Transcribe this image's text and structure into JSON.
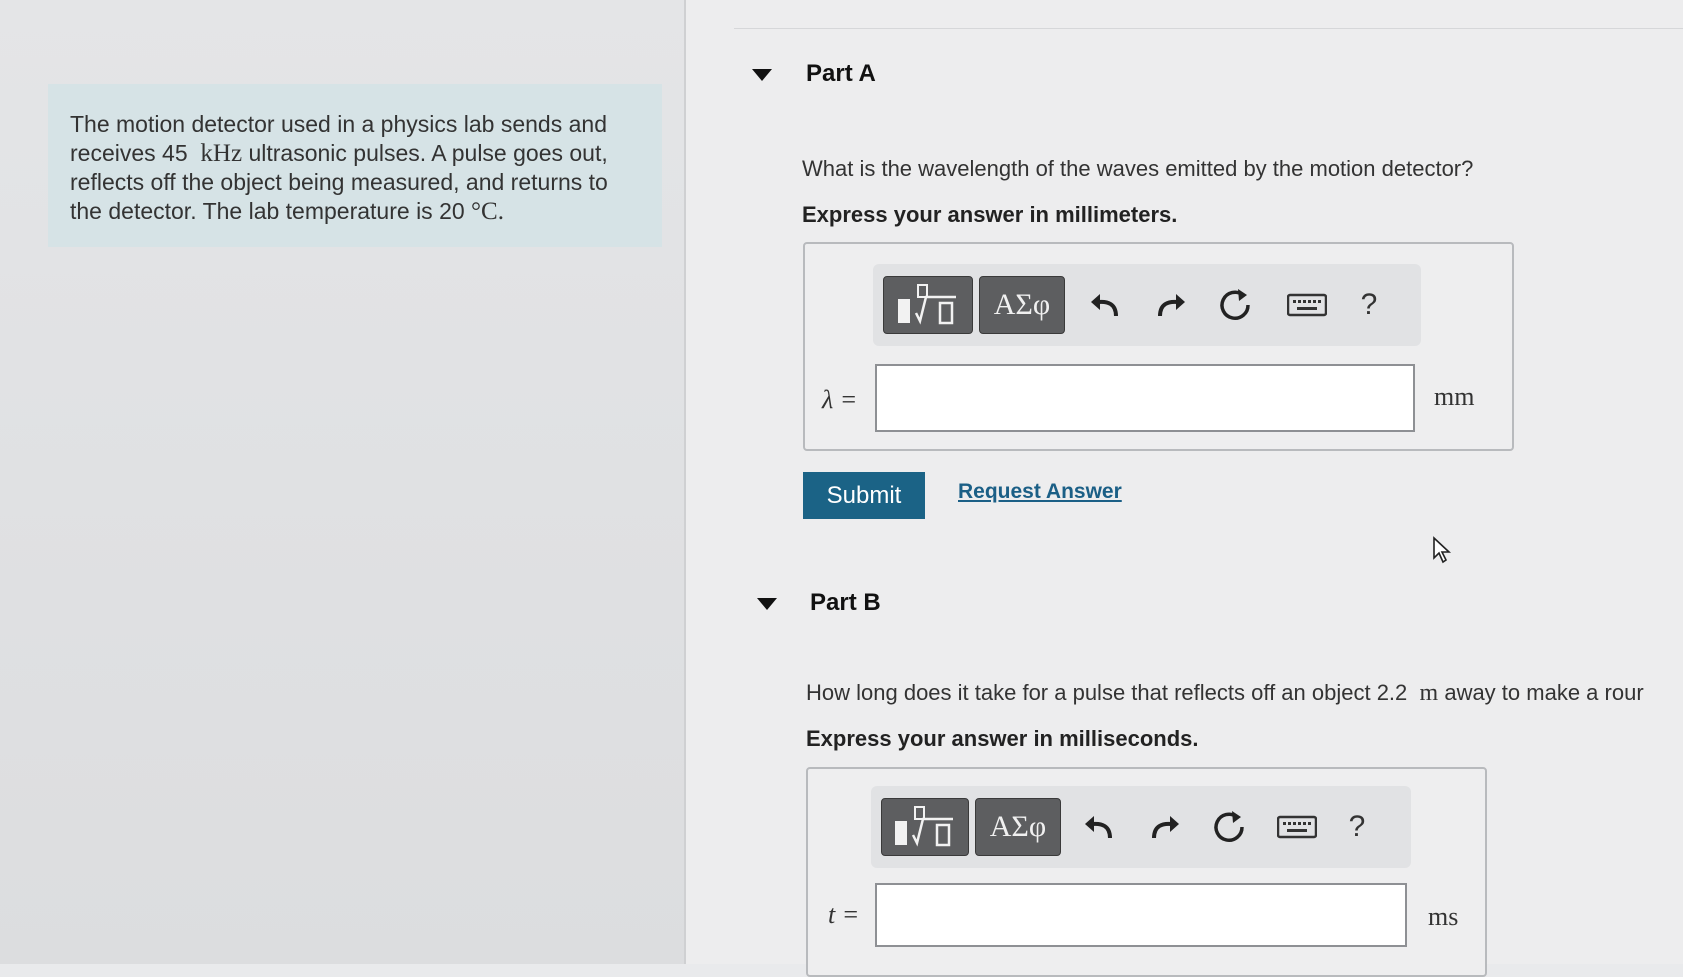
{
  "problem": {
    "line1": "The motion detector used in a physics lab sends and",
    "line2_pre": "receives 45",
    "line2_unit": "kHz",
    "line2_post": "ultrasonic pulses. A pulse goes out,",
    "line3": "reflects off the object being measured, and returns to",
    "line4_pre": "the detector. The lab temperature is 20",
    "line4_unit": "°C."
  },
  "part_a": {
    "title": "Part A",
    "question": "What is the wavelength of the waves emitted by the motion detector?",
    "instruction": "Express your answer in millimeters.",
    "variable": "λ =",
    "input_value": "",
    "unit": "mm",
    "submit_label": "Submit",
    "request_label": "Request Answer"
  },
  "part_b": {
    "title": "Part B",
    "question_pre": "How long does it take for a pulse that reflects off an object 2.2",
    "question_unit": "m",
    "question_post": "away to make a rour",
    "instruction": "Express your answer in milliseconds.",
    "variable": "t =",
    "input_value": "",
    "unit": "ms"
  },
  "toolbar": {
    "symbols_label": "ΑΣφ",
    "help_label": "?"
  },
  "icons": [
    "collapse-icon",
    "templates-icon",
    "undo-icon",
    "redo-icon",
    "reset-icon",
    "keyboard-icon",
    "help-icon",
    "mouse-cursor-icon"
  ],
  "colors": {
    "submit": "#1b6386",
    "link": "#1b5f86",
    "problem_bg": "#d6e3e6",
    "toolbar_button": "#5d5e60"
  }
}
